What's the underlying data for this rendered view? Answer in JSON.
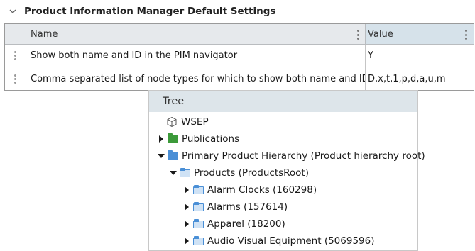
{
  "settings_panel": {
    "title": "Product Information Manager Default Settings",
    "columns": {
      "name": "Name",
      "value": "Value"
    },
    "rows": [
      {
        "name": "Show both name and ID in the PIM navigator",
        "value": "Y"
      },
      {
        "name": "Comma separated list of node types for which to show both name and ID",
        "value": "D,x,t,1,p,d,a,u,m"
      }
    ]
  },
  "tree": {
    "header": "Tree",
    "nodes": [
      {
        "label": "WSEP",
        "icon": "cube-icon"
      },
      {
        "label": "Publications",
        "icon": "green-folder-icon",
        "toggle": "collapsed"
      },
      {
        "label": "Primary Product Hierarchy (Product hierarchy root)",
        "icon": "blue-folder-icon",
        "toggle": "expanded"
      },
      {
        "label": "Products (ProductsRoot)",
        "icon": "blue-folder-icon",
        "toggle": "expanded"
      },
      {
        "label": "Alarm Clocks (160298)",
        "icon": "blue-folder-icon",
        "toggle": "collapsed"
      },
      {
        "label": "Alarms (157614)",
        "icon": "blue-folder-icon",
        "toggle": "collapsed"
      },
      {
        "label": "Apparel (18200)",
        "icon": "blue-folder-icon",
        "toggle": "collapsed"
      },
      {
        "label": "Audio Visual Equipment (5069596)",
        "icon": "blue-folder-icon",
        "toggle": "collapsed"
      }
    ]
  },
  "colors": {
    "grid_header": "#e6e9ec",
    "value_header": "#d6e2ea",
    "tree_header": "#dde5ea",
    "folder_green": "#3c9a3a",
    "folder_blue": "#4a8fd6"
  }
}
